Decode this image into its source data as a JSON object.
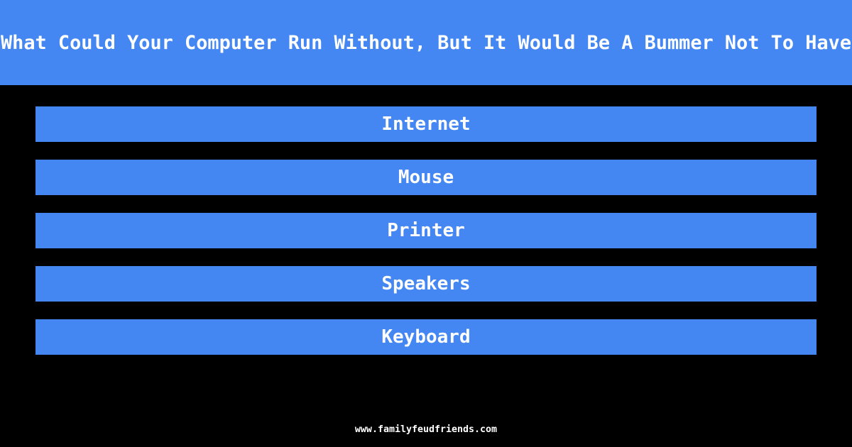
{
  "question": "What Could Your Computer Run Without, But It Would Be A Bummer Not To Have",
  "answers": [
    "Internet",
    "Mouse",
    "Printer",
    "Speakers",
    "Keyboard"
  ],
  "footer": "www.familyfeudfriends.com",
  "colors": {
    "accent": "#4487f2",
    "background": "#000000",
    "text": "#ffffff"
  }
}
